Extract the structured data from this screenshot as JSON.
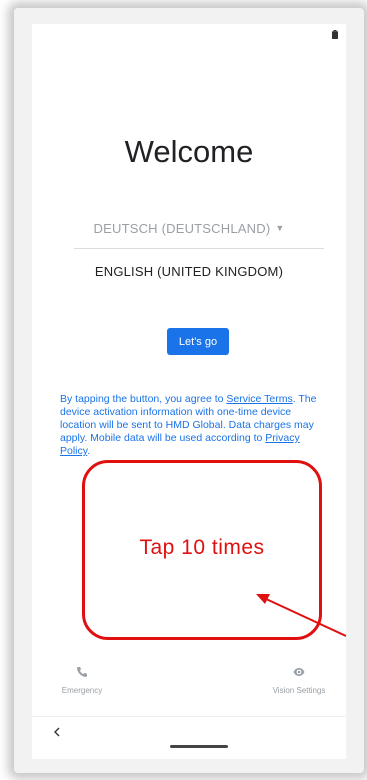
{
  "screen": {
    "title": "Welcome",
    "languages": {
      "secondary": "DEUTSCH (DEUTSCHLAND)",
      "selected": "ENGLISH (UNITED KINGDOM)"
    },
    "primary_button": "Let's go",
    "terms": {
      "part1": "By tapping the button, you agree to ",
      "service_terms_link": "Service Terms",
      "part2": ". The device activation information with one-time device location will be sent to HMD Global. Data charges may apply. Mobile data will be used according to ",
      "privacy_link": "Privacy Policy",
      "part3": "."
    },
    "bottom": {
      "emergency_label": "Emergency",
      "emergency_icon": "phone-icon",
      "vision_label": "Vision Settings",
      "vision_icon": "eye-icon"
    }
  },
  "annotation": {
    "label": "Tap 10 times",
    "color": "#e01010"
  },
  "colors": {
    "accent": "#1a73e8",
    "text_primary": "#202124",
    "text_muted": "#9aa0a6"
  }
}
